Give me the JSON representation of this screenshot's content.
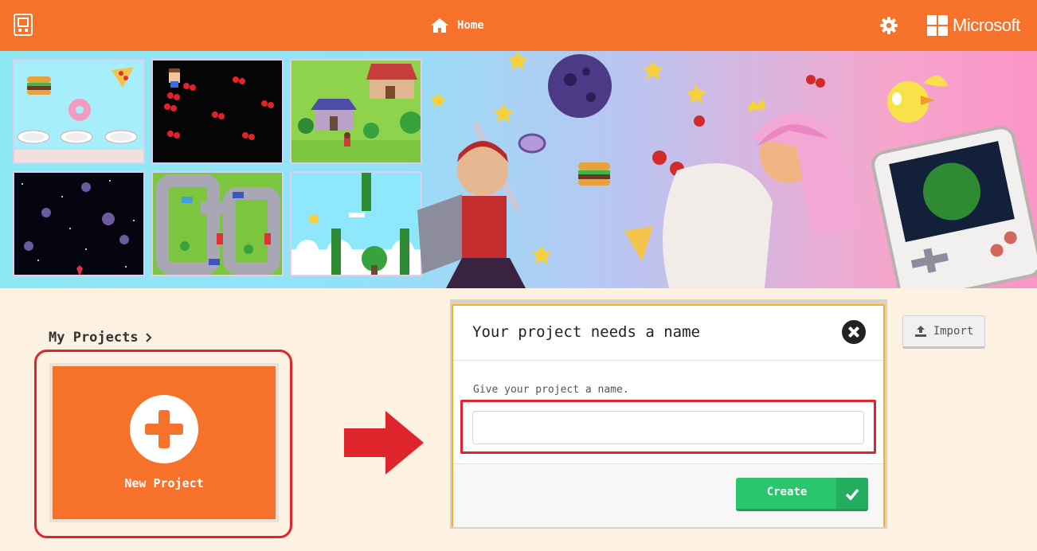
{
  "topbar": {
    "home_label": "Home",
    "brand": "Microsoft",
    "icons": [
      "arcade-logo-icon",
      "home-icon",
      "gear-icon",
      "microsoft-logo-icon"
    ],
    "color": "#f6722b"
  },
  "hero": {
    "gallery": [
      "food-drop-game",
      "cherry-collector-game",
      "village-adventure-game",
      "space-shooter-game",
      "race-track-game",
      "flappy-duck-game"
    ]
  },
  "projects": {
    "heading": "My Projects",
    "new_project_label": "New Project"
  },
  "dialog": {
    "title": "Your project needs a name",
    "prompt": "Give your project a name.",
    "input_value": "",
    "create_label": "Create"
  },
  "import_label": "Import",
  "colors": {
    "accent": "#f6722b",
    "highlight": "#e0242b",
    "create_green": "#2ac56c",
    "dialog_border": "#f2b21f"
  }
}
